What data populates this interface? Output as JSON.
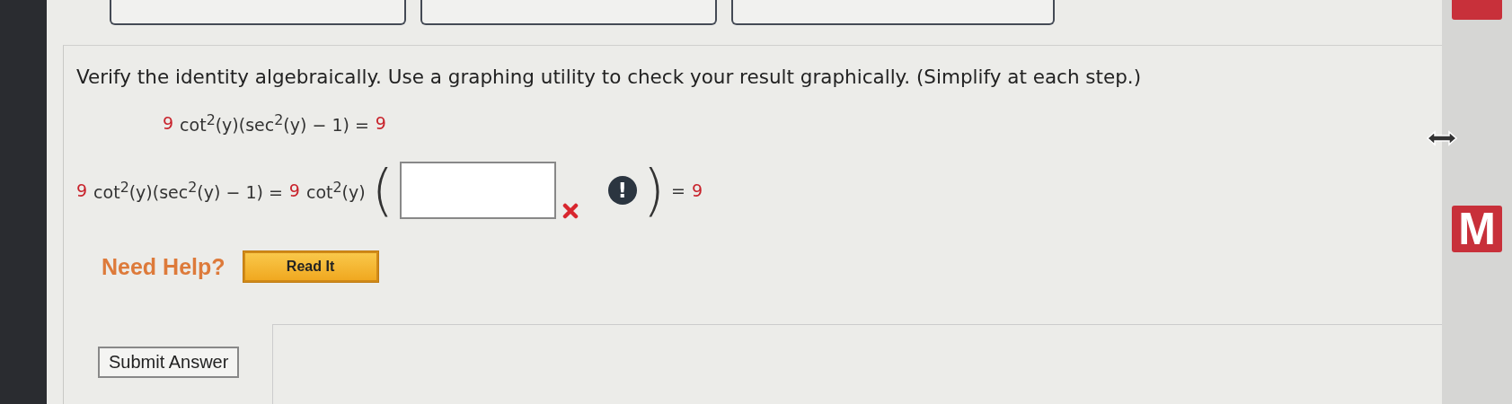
{
  "top_buttons": [
    {
      "kind": "cut"
    },
    {
      "kind": "cut"
    },
    {
      "kind": "cut"
    }
  ],
  "question": {
    "prompt": "Verify the identity algebraically. Use a graphing utility to check your result graphically. (Simplify at each step.)",
    "given": [
      {
        "kind": "num",
        "text": "9"
      },
      {
        "kind": "expr",
        "text": "cot$^{2}$(y)(sec$^{2}$(y) − 1) ="
      },
      {
        "kind": "num",
        "text": "9"
      }
    ],
    "step_left": [
      {
        "kind": "num",
        "text": "9"
      },
      {
        "kind": "expr",
        "text": "cot$^{2}$(y)(sec$^{2}$(y) − 1) ="
      },
      {
        "kind": "num",
        "text": "9"
      },
      {
        "kind": "expr",
        "text": "cot$^{2}$(y)"
      }
    ],
    "open_paren": "(",
    "answer": {
      "incorrect": true
    },
    "alert": "!",
    "close_paren": ")",
    "step_right": [
      {
        "kind": "expr",
        "text": "="
      },
      {
        "kind": "num",
        "text": "9"
      }
    ]
  },
  "help": {
    "label": "Need Help?",
    "buttons": [
      "Read It"
    ]
  },
  "submit": "Submit Answer",
  "side_logos": [
    {
      "kind": "cut"
    },
    {
      "kind": "full",
      "letter": "M"
    }
  ]
}
